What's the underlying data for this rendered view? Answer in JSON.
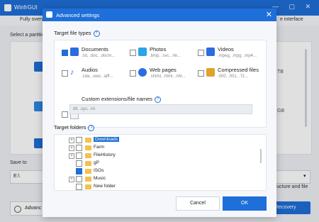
{
  "background": {
    "app_title": "WinfrGUI",
    "tab_left": "Fully overw",
    "tab_right": "e interface",
    "select_partition_label": "Select a partition",
    "partition_sizes": [
      "TB",
      "GB"
    ],
    "save_to_label": "Save to",
    "save_path": "E:\\",
    "structure_text": "tructure and file",
    "advanced_label": "Advanc",
    "recovery_label": "Recovery"
  },
  "dialog": {
    "title": "Advanced settings",
    "target_file_types_label": "Target file types",
    "file_types": [
      {
        "title": "Documents",
        "sub": ".txt, .doc, .docm...",
        "checked": true,
        "icon": "document-icon",
        "color": "#2b6de0"
      },
      {
        "title": "Photos",
        "sub": ".bmp, .svc, .rle...",
        "checked": false,
        "icon": "photo-icon",
        "color": "#2aa3e8"
      },
      {
        "title": "Videos",
        "sub": ".mpeg, .mpg, .mp4...",
        "checked": false,
        "icon": "video-icon",
        "color": "#2b6de0"
      },
      {
        "title": "Audios",
        "sub": ".cda, .wav, .aiff...",
        "checked": false,
        "icon": "music-note-icon",
        "color": "#2b6de0"
      },
      {
        "title": "Web pages",
        "sub": ".shtml, .html, .nht...",
        "checked": false,
        "icon": "globe-icon",
        "color": "#2b6de0"
      },
      {
        "title": "Compressed files",
        "sub": ".000, .001, .7z...",
        "checked": false,
        "icon": "archive-icon",
        "color": "#e0a22b"
      }
    ],
    "custom_label": "Custom extensions/file names",
    "custom_placeholder": "dll, .sys, .ini",
    "target_folders_label": "Target folders",
    "folders": [
      {
        "name": "Downloads",
        "checked": false,
        "selected": true
      },
      {
        "name": "Farm",
        "checked": false,
        "selected": false
      },
      {
        "name": "FileHistory",
        "checked": false,
        "selected": false
      },
      {
        "name": "gP",
        "checked": false,
        "selected": false
      },
      {
        "name": "ISOs",
        "checked": true,
        "selected": false
      },
      {
        "name": "Music",
        "checked": false,
        "selected": false
      },
      {
        "name": "New folder",
        "checked": false,
        "selected": false
      }
    ],
    "cancel_label": "Cancel",
    "ok_label": "OK"
  }
}
